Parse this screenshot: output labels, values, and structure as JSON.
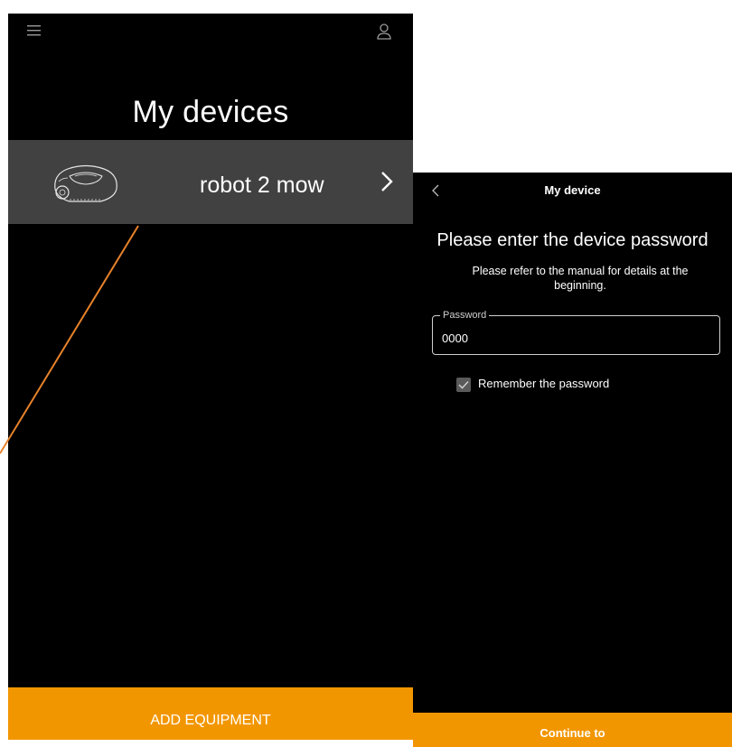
{
  "left_screen": {
    "title": "My devices",
    "devices": [
      {
        "name": "robot 2 mow"
      }
    ],
    "add_button_label": "ADD EQUIPMENT",
    "icons": {
      "menu": "hamburger-menu-icon",
      "account": "user-icon",
      "device_next": "chevron-right-icon"
    }
  },
  "right_screen": {
    "header_title": "My device",
    "heading": "Please enter the device password",
    "subtext": "Please refer to the manual for details at the beginning.",
    "password_field": {
      "label": "Password",
      "value": "0000"
    },
    "remember": {
      "label": "Remember the password",
      "checked": true
    },
    "continue_label": "Continue to",
    "icons": {
      "back": "chevron-left-icon",
      "checkbox": "check-icon"
    }
  },
  "colors": {
    "accent": "#f29600",
    "background": "#000000",
    "device_row": "#414141",
    "annotation_line": "#e8822a"
  }
}
